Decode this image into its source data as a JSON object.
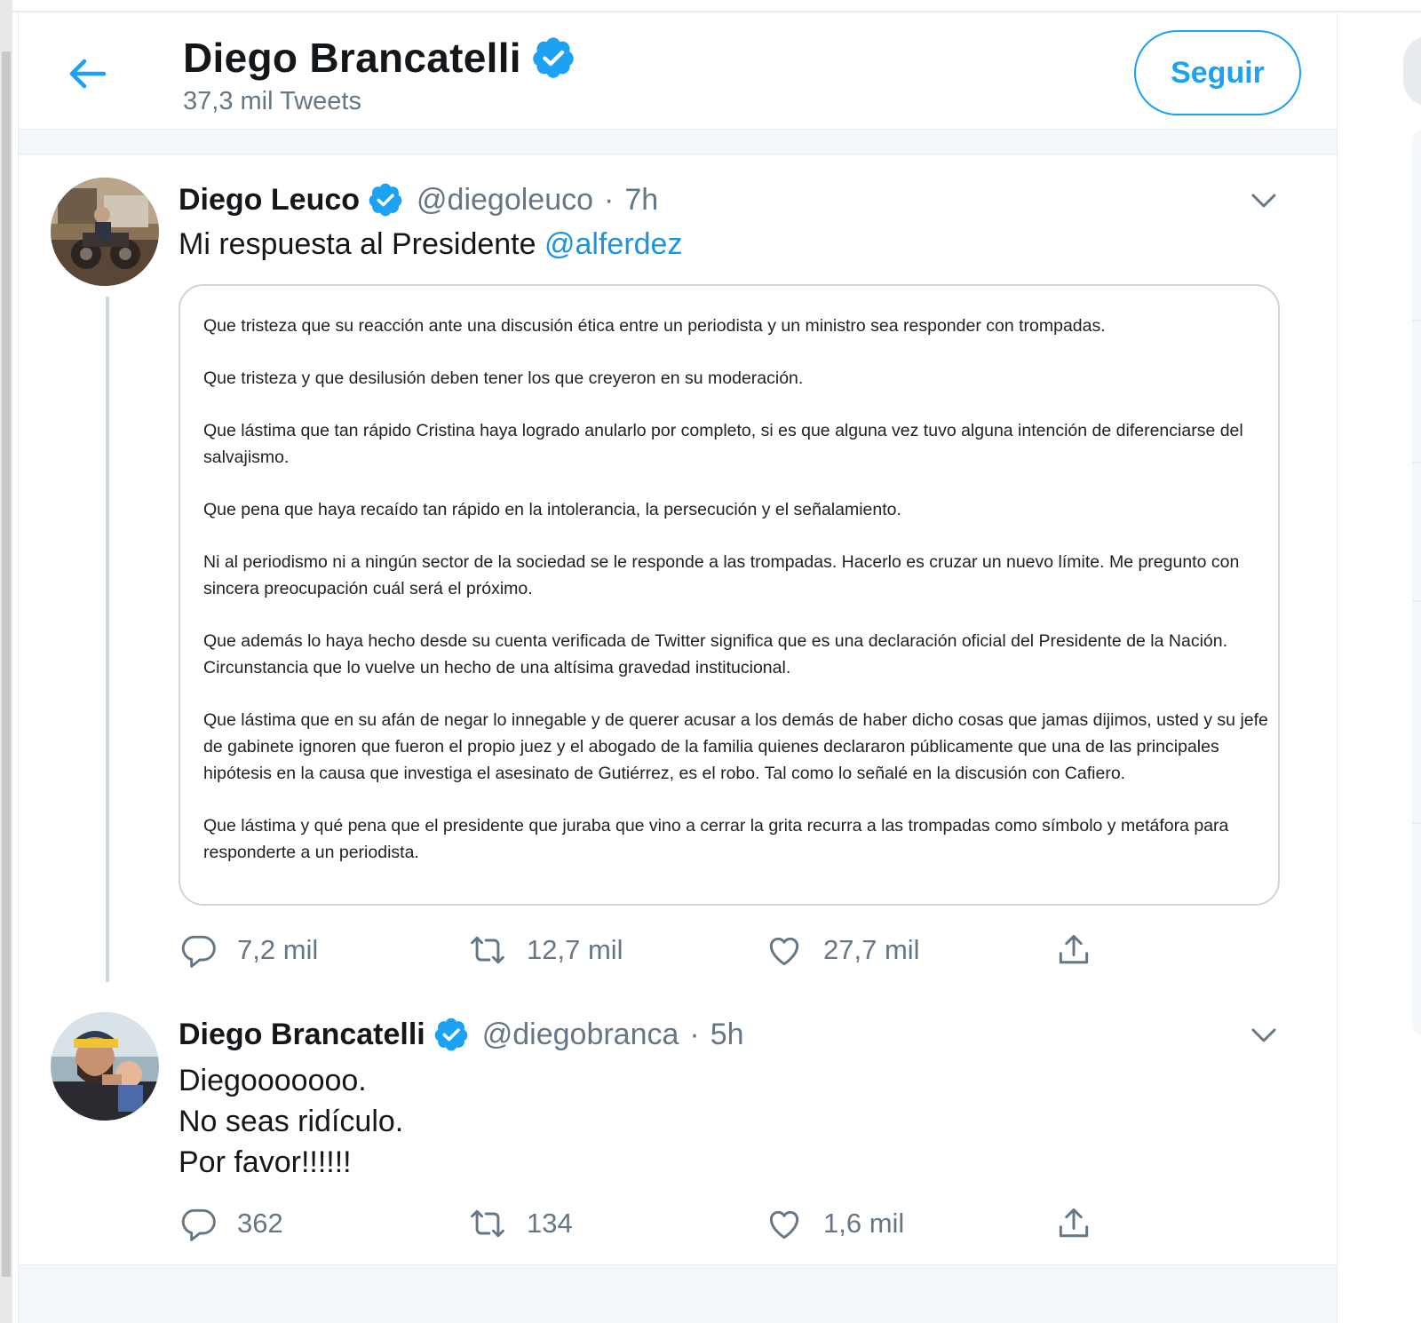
{
  "header": {
    "name": "Diego Brancatelli",
    "tweets_count": "37,3 mil Tweets",
    "follow_label": "Seguir"
  },
  "tweets": [
    {
      "name": "Diego Leuco",
      "handle": "@diegoleuco",
      "separator": "·",
      "time": "7h",
      "text": "Mi respuesta al Presidente ",
      "mention": "@alferdez",
      "attached_text": [
        "Que tristeza que su reacción ante una discusión ética entre un periodista y un ministro sea responder con trompadas.",
        "Que tristeza y que desilusión deben tener los que creyeron en su moderación.",
        "Que lástima que tan rápido Cristina haya logrado anularlo por completo, si es que alguna vez tuvo alguna intención de diferenciarse del salvajismo.",
        "Que pena que haya recaído tan rápido en la intolerancia, la persecución y el señalamiento.",
        "Ni al periodismo ni a ningún sector de la sociedad se le responde a las trompadas. Hacerlo es cruzar un nuevo límite. Me pregunto con sincera preocupación cuál será el próximo.",
        "Que además lo haya hecho desde su cuenta verificada de Twitter significa que es una declaración oficial del Presidente de la Nación. Circunstancia que lo vuelve un hecho de una altísima gravedad institucional.",
        "Que lástima que en su afán de negar lo innegable y de querer acusar a los demás de haber dicho cosas que jamas dijimos, usted y su jefe de gabinete ignoren que fueron el propio juez y el abogado de la familia quienes declararon públicamente que una de las principales hipótesis en la causa que investiga el asesinato de Gutiérrez, es el robo. Tal como lo señalé en la discusión con Cafiero.",
        "Que lástima y qué pena que el presidente que juraba que vino a cerrar la grita recurra a las trompadas como símbolo y metáfora para responderte a un periodista."
      ],
      "replies": "7,2 mil",
      "retweets": "12,7 mil",
      "likes": "27,7 mil"
    },
    {
      "name": "Diego Brancatelli",
      "handle": "@diegobranca",
      "separator": "·",
      "time": "5h",
      "lines": [
        "Diegooooooo.",
        "No seas ridículo.",
        "Por favor!!!!!!"
      ],
      "replies": "362",
      "retweets": "134",
      "likes": "1,6 mil"
    }
  ],
  "icons": {
    "back": "arrow-left-icon",
    "verified": "verified-badge-icon",
    "chevron": "chevron-down-icon",
    "reply": "reply-icon",
    "retweet": "retweet-icon",
    "like": "heart-icon",
    "share": "share-icon"
  },
  "colors": {
    "accent": "#1da1f2",
    "link": "#1b95e0",
    "secondary_text": "#657786",
    "border": "#e6ecf0"
  }
}
